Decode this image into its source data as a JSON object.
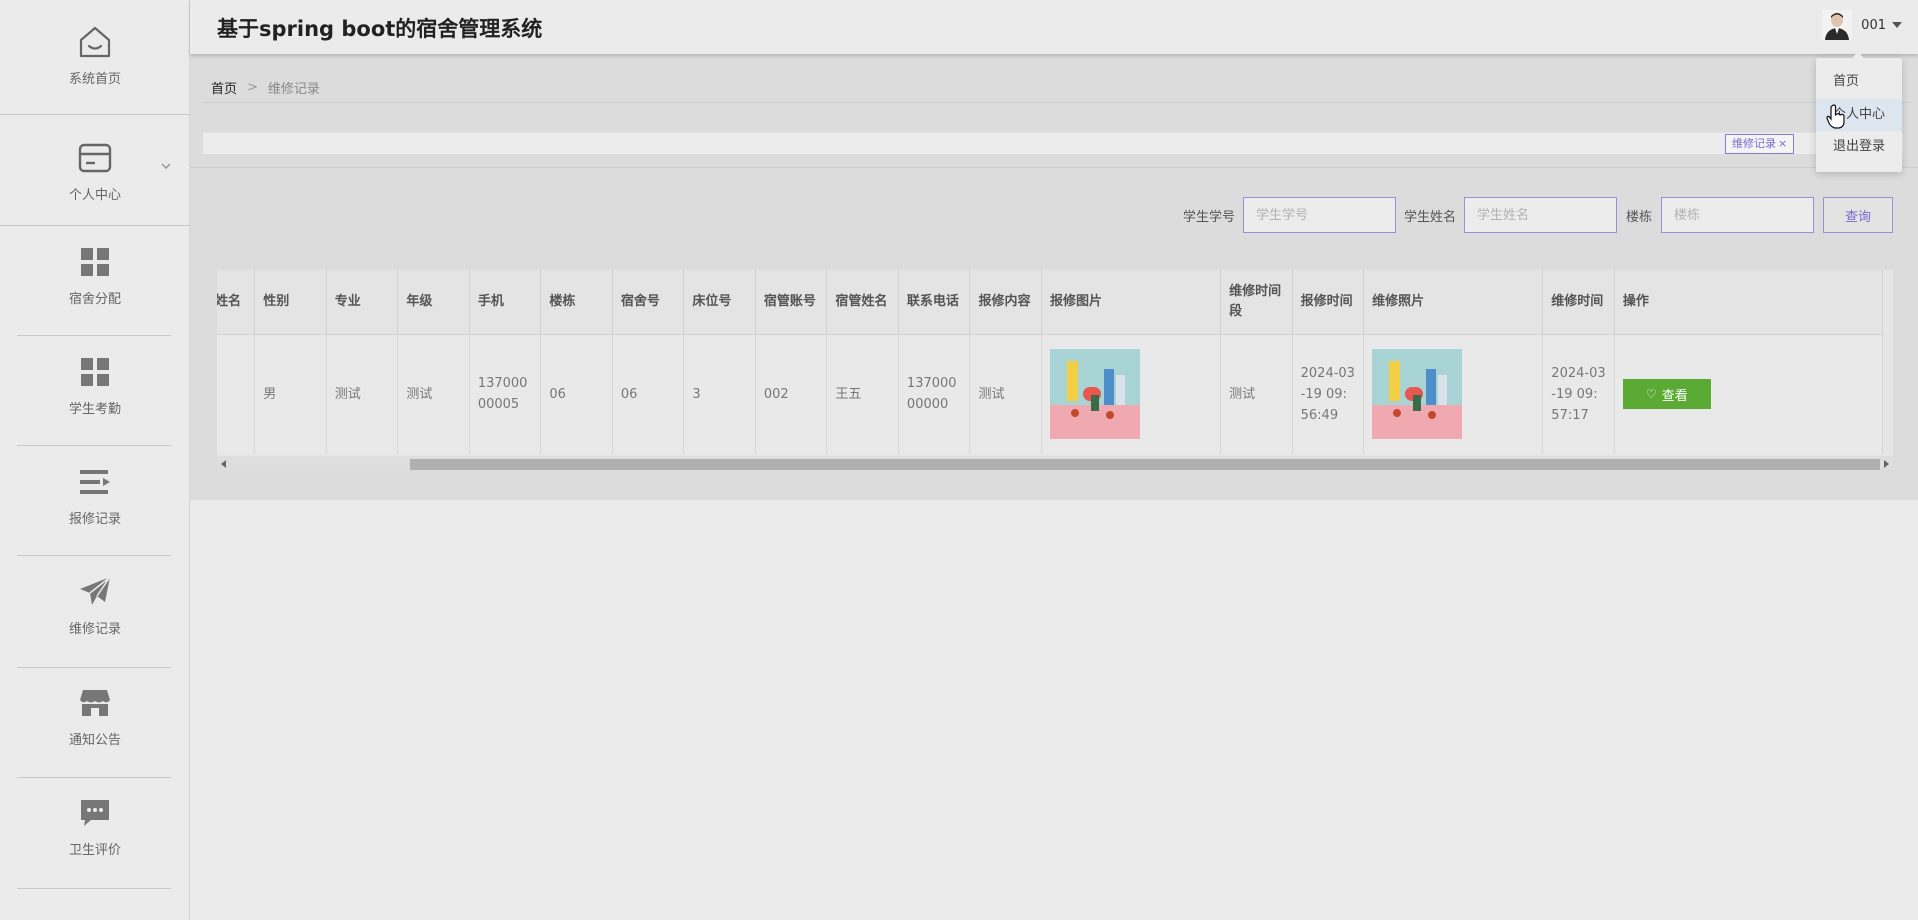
{
  "app": {
    "title": "基于spring boot的宿舍管理系统"
  },
  "user": {
    "name": "001"
  },
  "user_menu": [
    "首页",
    "个人中心",
    "退出登录"
  ],
  "sidebar": {
    "items": [
      {
        "label": "系统首页",
        "icon": "home-icon"
      },
      {
        "label": "个人中心",
        "icon": "card-icon"
      },
      {
        "label": "宿舍分配",
        "icon": "grid-icon"
      },
      {
        "label": "学生考勤",
        "icon": "grid-icon"
      },
      {
        "label": "报修记录",
        "icon": "list-icon"
      },
      {
        "label": "维修记录",
        "icon": "paper-plane-icon"
      },
      {
        "label": "通知公告",
        "icon": "store-icon"
      },
      {
        "label": "卫生评价",
        "icon": "chat-icon"
      }
    ]
  },
  "breadcrumb": {
    "home": "首页",
    "separator": ">",
    "current": "维修记录"
  },
  "tags": [
    {
      "label": "维修记录",
      "close": "×"
    }
  ],
  "search": {
    "student_no_label": "学生学号",
    "student_no_placeholder": "学生学号",
    "student_name_label": "学生姓名",
    "student_name_placeholder": "学生姓名",
    "building_label": "楼栋",
    "building_placeholder": "楼栋",
    "query_button": "查询"
  },
  "table": {
    "columns": [
      "姓名",
      "性别",
      "专业",
      "年级",
      "手机",
      "楼栋",
      "宿舍号",
      "床位号",
      "宿管账号",
      "宿管姓名",
      "联系电话",
      "报修内容",
      "报修图片",
      "维修时间段",
      "报修时间",
      "维修照片",
      "维修时间",
      "操作"
    ],
    "rows": [
      {
        "name": "",
        "gender": "男",
        "major": "测试",
        "grade": "测试",
        "phone": "13700000005",
        "building": "06",
        "room": "06",
        "bed": "3",
        "manager_account": "002",
        "manager_name": "王五",
        "contact_phone": "13700000000",
        "repair_content": "测试",
        "repair_period": "测试",
        "report_time": "2024-03-19 09:56:49",
        "repair_time": "2024-03-19 09:57:17",
        "action": "查看"
      }
    ]
  },
  "colors": {
    "accent": "#7a68d0",
    "view_button": "#5aaa34",
    "hover_row": "#dde5ee"
  }
}
